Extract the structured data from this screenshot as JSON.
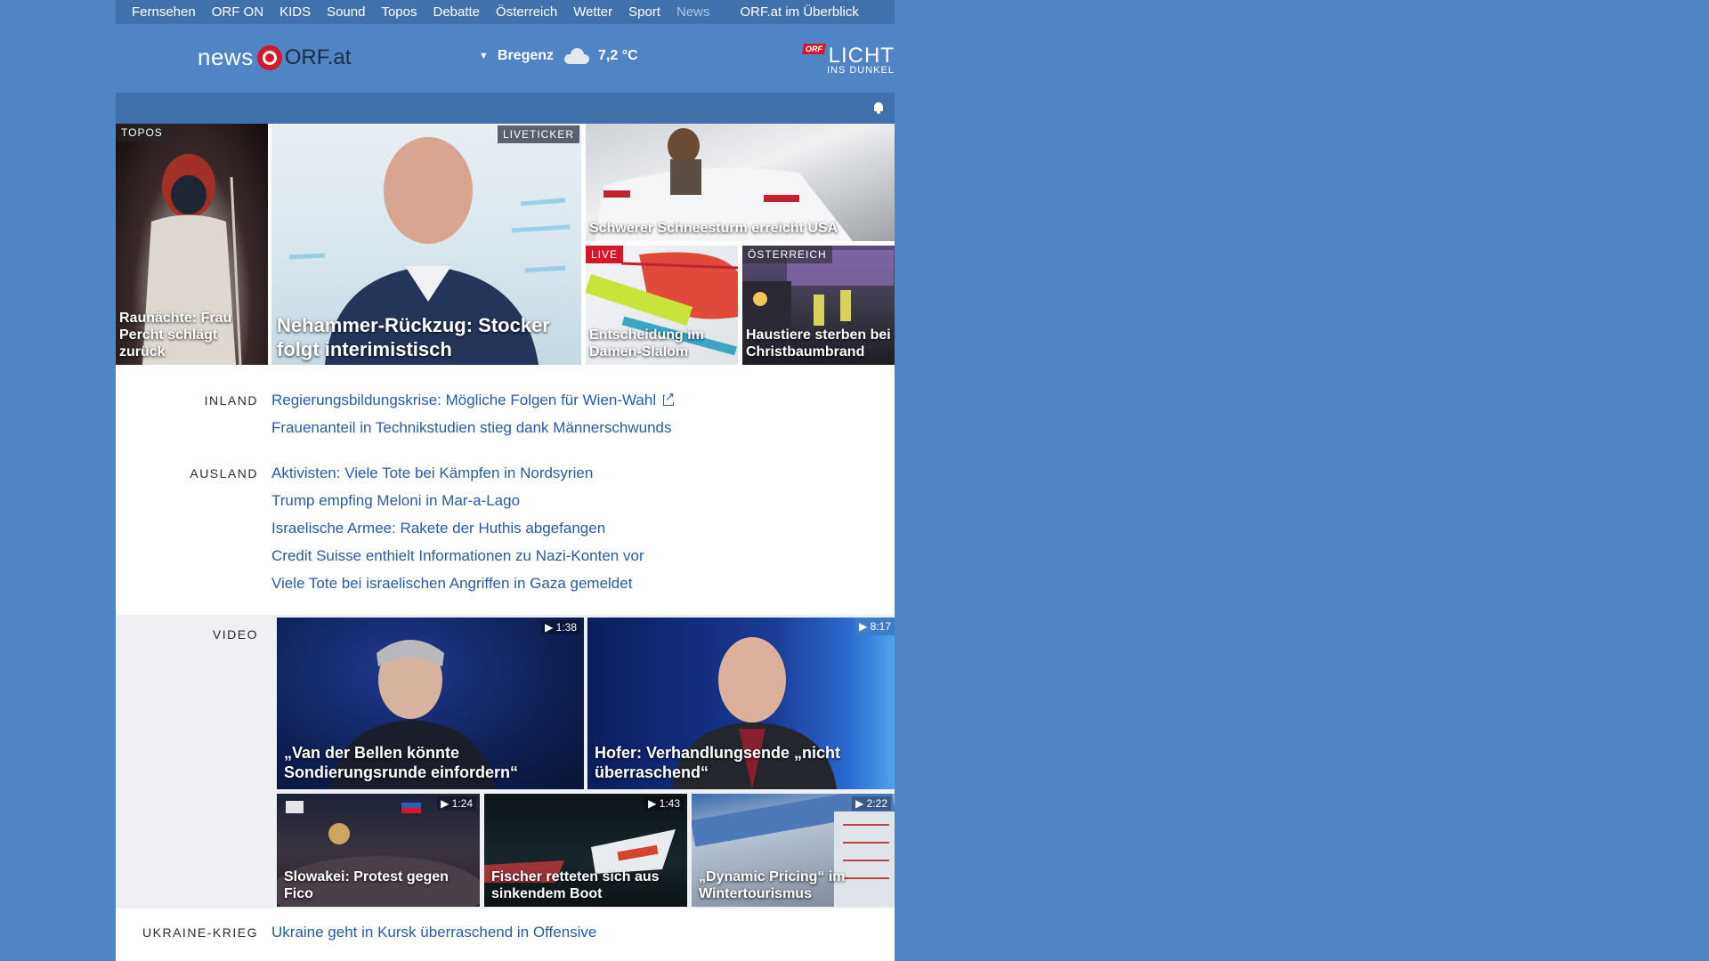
{
  "topnav": {
    "items": [
      "Fernsehen",
      "ORF ON",
      "KIDS",
      "Sound",
      "Topos",
      "Debatte",
      "Österreich",
      "Wetter",
      "Sport",
      "News"
    ],
    "overview": "ORF.at im Überblick"
  },
  "header": {
    "logo_news": "news",
    "logo_orf": "ORF.at",
    "weather_location": "Bregenz",
    "weather_temp": "7,2 °C",
    "licht_orf": "ORF",
    "licht_big": "LICHT",
    "licht_small": "INS DUNKEL"
  },
  "colors": {
    "brand_red": "#d4172a",
    "link_blue": "#2a5ba0",
    "background": "#4f85c4"
  },
  "teasers": [
    {
      "tag": "TOPOS",
      "title": "Raunächte: Frau Percht schlägt zurück"
    },
    {
      "tag": "LIVETICKER",
      "title": "Nehammer-Rückzug: Stocker folgt interimistisch"
    },
    {
      "tag": "",
      "title": "Schwerer Schneesturm erreicht USA"
    },
    {
      "tag": "LIVE",
      "title": "Entscheidung im Damen-Slalom"
    },
    {
      "tag": "ÖSTERREICH",
      "title": "Haustiere sterben bei Christbaumbrand"
    }
  ],
  "inland": {
    "label": "INLAND",
    "items": [
      "Regierungsbildungskrise: Mögliche Folgen für Wien-Wahl",
      "Frauenanteil in Technikstudien stieg dank Männerschwunds"
    ]
  },
  "ausland": {
    "label": "AUSLAND",
    "items": [
      "Aktivisten: Viele Tote bei Kämpfen in Nordsyrien",
      "Trump empfing Meloni in Mar-a-Lago",
      "Israelische Armee: Rakete der Huthis abgefangen",
      "Credit Suisse enthielt Informationen zu Nazi-Konten vor",
      "Viele Tote bei israelischen Angriffen in Gaza gemeldet"
    ]
  },
  "video": {
    "label": "VIDEO",
    "items": [
      {
        "duration": "1:38",
        "title": "„Van der Bellen könnte Sondierungsrunde einfordern“"
      },
      {
        "duration": "8:17",
        "title": "Hofer: Verhandlungsende „nicht überraschend“"
      },
      {
        "duration": "1:24",
        "title": "Slowakei: Protest gegen Fico"
      },
      {
        "duration": "1:43",
        "title": "Fischer retteten sich aus sinkendem Boot"
      },
      {
        "duration": "2:22",
        "title": "„Dynamic Pricing“ im Wintertourismus"
      }
    ]
  },
  "ukraine": {
    "label": "UKRAINE-KRIEG",
    "items": [
      "Ukraine geht in Kursk überraschend in Offensive"
    ]
  }
}
